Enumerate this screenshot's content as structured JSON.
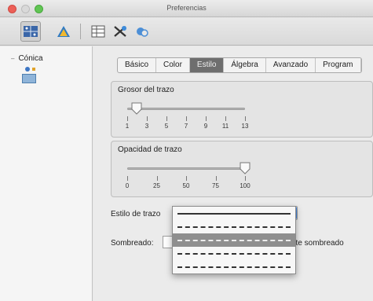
{
  "window": {
    "title": "Preferencias"
  },
  "toolbar": {
    "buttons": [
      {
        "icon": "graphics-view-icon"
      },
      {
        "icon": "geometry-triangle-icon"
      },
      {
        "icon": "spreadsheet-icon"
      },
      {
        "icon": "cas-tools-icon"
      },
      {
        "icon": "defaults-icon"
      }
    ]
  },
  "sidebar": {
    "root_label": "Cónica",
    "root_toggle": "–"
  },
  "tabs": [
    {
      "label": "Básico"
    },
    {
      "label": "Color"
    },
    {
      "label": "Estilo",
      "active": true
    },
    {
      "label": "Álgebra"
    },
    {
      "label": "Avanzado"
    },
    {
      "label": "Program"
    }
  ],
  "line_thickness": {
    "title": "Grosor del trazo",
    "ticks": [
      "1",
      "3",
      "5",
      "7",
      "9",
      "11",
      "13"
    ],
    "value": 2
  },
  "line_opacity": {
    "title": "Opacidad de trazo",
    "ticks": [
      "0",
      "25",
      "50",
      "75",
      "100"
    ],
    "value": 100
  },
  "line_style": {
    "label": "Estilo de trazo",
    "options": [
      "solid",
      "dashed-long",
      "dashed-medium",
      "dashed-short"
    ],
    "selected_index": 2
  },
  "shading": {
    "label": "Sombreado:",
    "right_label": "nte sombreado"
  },
  "colors": {
    "accent": "#4b8ee6",
    "selected_row": "#8f8f8f"
  }
}
